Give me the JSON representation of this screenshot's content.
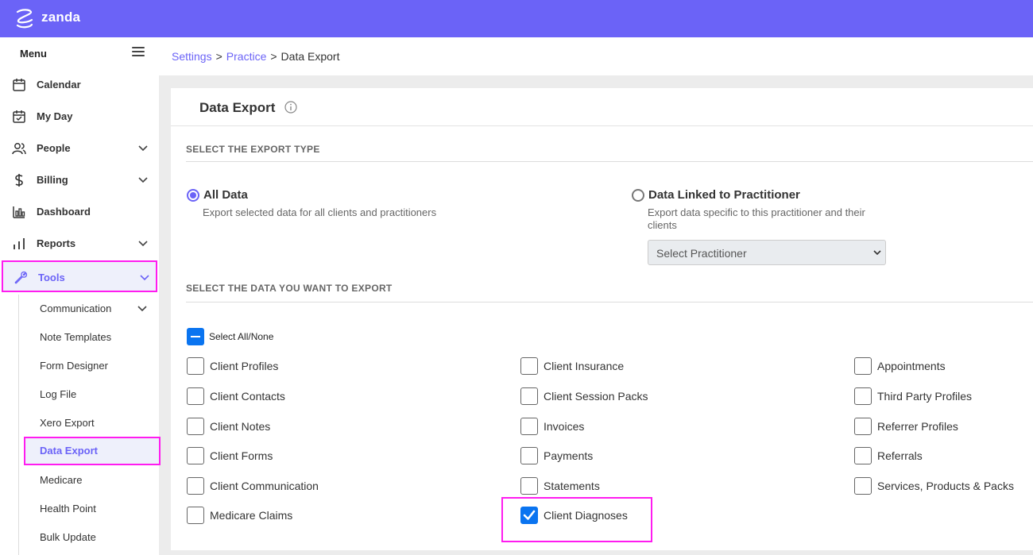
{
  "app": {
    "brand": "zanda"
  },
  "sidebar": {
    "menu_label": "Menu",
    "items": [
      {
        "label": "Calendar",
        "icon": "calendar-icon"
      },
      {
        "label": "My Day",
        "icon": "calendar-check-icon"
      },
      {
        "label": "People",
        "icon": "people-icon",
        "has_children": true
      },
      {
        "label": "Billing",
        "icon": "dollar-icon",
        "has_children": true
      },
      {
        "label": "Dashboard",
        "icon": "dashboard-icon"
      },
      {
        "label": "Reports",
        "icon": "bar-chart-icon",
        "has_children": true
      },
      {
        "label": "Tools",
        "icon": "wrench-icon",
        "has_children": true,
        "active": true
      }
    ],
    "tools_sub": [
      {
        "label": "Communication",
        "has_children": true
      },
      {
        "label": "Note Templates"
      },
      {
        "label": "Form Designer"
      },
      {
        "label": "Log File"
      },
      {
        "label": "Xero Export"
      },
      {
        "label": "Data Export",
        "active": true
      },
      {
        "label": "Medicare"
      },
      {
        "label": "Health Point"
      },
      {
        "label": "Bulk Update"
      }
    ]
  },
  "breadcrumb": {
    "settings": "Settings",
    "practice": "Practice",
    "current": "Data Export",
    "separator": ">"
  },
  "card": {
    "title": "Data Export",
    "export_type_heading": "SELECT THE EXPORT TYPE",
    "options": {
      "all": {
        "label": "All Data",
        "description": "Export selected data for all clients and practitioners",
        "selected": true
      },
      "linked": {
        "label": "Data Linked to Practitioner",
        "description": "Export data specific to this practitioner and their clients",
        "selected": false
      }
    },
    "practitioner_select": {
      "value": "Select Practitioner"
    },
    "data_heading": "SELECT THE DATA YOU WANT TO EXPORT",
    "select_all_label": "Select All/None",
    "checkboxes": {
      "col1": [
        {
          "label": "Client Profiles",
          "checked": false
        },
        {
          "label": "Client Contacts",
          "checked": false
        },
        {
          "label": "Client Notes",
          "checked": false
        },
        {
          "label": "Client Forms",
          "checked": false
        },
        {
          "label": "Client Communication",
          "checked": false
        },
        {
          "label": "Medicare Claims",
          "checked": false
        }
      ],
      "col2": [
        {
          "label": "Client Insurance",
          "checked": false
        },
        {
          "label": "Client Session Packs",
          "checked": false
        },
        {
          "label": "Invoices",
          "checked": false
        },
        {
          "label": "Payments",
          "checked": false
        },
        {
          "label": "Statements",
          "checked": false
        },
        {
          "label": "Client Diagnoses",
          "checked": true
        }
      ],
      "col3": [
        {
          "label": "Appointments",
          "checked": false
        },
        {
          "label": "Third Party Profiles",
          "checked": false
        },
        {
          "label": "Referrer Profiles",
          "checked": false
        },
        {
          "label": "Referrals",
          "checked": false
        },
        {
          "label": "Services, Products & Packs",
          "checked": false
        }
      ]
    }
  },
  "colors": {
    "brand": "#6b63f7",
    "highlight": "#ff1cf0",
    "checkbox_blue": "#0a74f0"
  }
}
